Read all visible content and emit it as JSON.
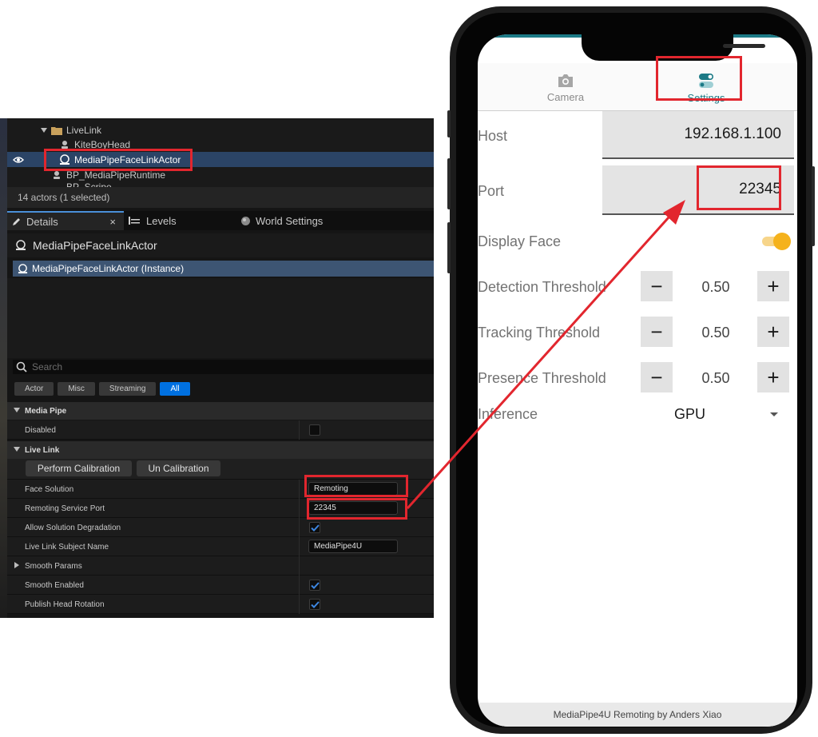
{
  "unreal": {
    "outliner": {
      "folder": "LiveLink",
      "items": [
        "KiteBoyHead",
        "MediaPipeFaceLinkActor",
        "BP_MediaPipeRuntime",
        "BP_Scripe"
      ],
      "actor_count": "14 actors (1 selected)"
    },
    "tabs": {
      "details": "Details",
      "close": "×",
      "levels": "Levels",
      "world_settings": "World Settings"
    },
    "details": {
      "title": "MediaPipeFaceLinkActor",
      "instance": "MediaPipeFaceLinkActor (Instance)",
      "search_placeholder": "Search",
      "filters": [
        "Actor",
        "Misc",
        "Streaming",
        "All"
      ],
      "active_filter": "All"
    },
    "categories": {
      "media_pipe": "Media Pipe",
      "live_link": "Live Link",
      "smooth_params": "Smooth Params"
    },
    "props": {
      "disabled": {
        "label": "Disabled",
        "checked": false
      },
      "perform_calibration": "Perform Calibration",
      "un_calibration": "Un Calibration",
      "face_solution": {
        "label": "Face Solution",
        "value": "Remoting"
      },
      "remoting_port": {
        "label": "Remoting Service Port",
        "value": "22345"
      },
      "allow_degradation": {
        "label": "Allow Solution Degradation",
        "checked": true
      },
      "subject_name": {
        "label": "Live Link Subject Name",
        "value": "MediaPipe4U"
      },
      "smooth_enabled": {
        "label": "Smooth Enabled",
        "checked": true
      },
      "publish_head_rotation": {
        "label": "Publish Head Rotation",
        "checked": true
      }
    }
  },
  "phone": {
    "tabs": {
      "camera": "Camera",
      "settings": "Settings",
      "active": "Settings"
    },
    "host": {
      "label": "Host",
      "value": "192.168.1.100"
    },
    "port": {
      "label": "Port",
      "value": "22345"
    },
    "display_face": {
      "label": "Display Face",
      "on": true
    },
    "detection": {
      "label": "Detection Threshold",
      "value": "0.50"
    },
    "tracking": {
      "label": "Tracking Threshold",
      "value": "0.50"
    },
    "presence": {
      "label": "Presence Threshold",
      "value": "0.50"
    },
    "inference": {
      "label": "Inference",
      "value": "GPU"
    },
    "stepper_minus": "−",
    "stepper_plus": "+",
    "footer": "MediaPipe4U Remoting by Anders Xiao"
  },
  "colors": {
    "accent_teal": "#1c7a86",
    "toggle_yellow": "#f5b21c",
    "annotation_red": "#e2262e",
    "ue_selection": "#2b4466",
    "ue_filter_on": "#0070e0"
  }
}
